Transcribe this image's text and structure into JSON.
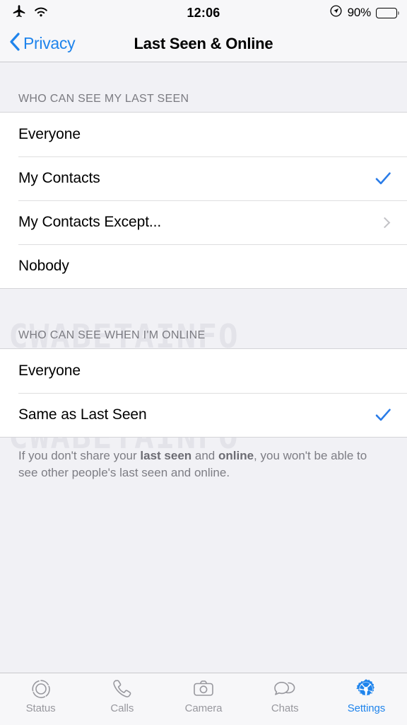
{
  "status_bar": {
    "airplane_icon": "airplane-icon",
    "wifi_icon": "wifi-icon",
    "time": "12:06",
    "location_icon": "location-icon",
    "battery_percent": "90%",
    "battery_level": 90,
    "battery_color": "#fcc202"
  },
  "nav": {
    "back_label": "Privacy",
    "back_icon": "chevron-left-icon",
    "title": "Last Seen & Online",
    "tint": "#1f84ec"
  },
  "watermark": "CWABETAINFO",
  "sections": [
    {
      "header": "WHO CAN SEE MY LAST SEEN",
      "rows": [
        {
          "label": "Everyone",
          "accessory": "none"
        },
        {
          "label": "My Contacts",
          "accessory": "check"
        },
        {
          "label": "My Contacts Except...",
          "accessory": "chevron"
        },
        {
          "label": "Nobody",
          "accessory": "none"
        }
      ]
    },
    {
      "header": "WHO CAN SEE WHEN I'M ONLINE",
      "rows": [
        {
          "label": "Everyone",
          "accessory": "none"
        },
        {
          "label": "Same as Last Seen",
          "accessory": "check"
        }
      ]
    }
  ],
  "footer": {
    "part1": "If you don't share your ",
    "bold1": "last seen",
    "part2": " and ",
    "bold2": "online",
    "part3": ", you won't be able to see other people's last seen and online."
  },
  "tabbar": {
    "items": [
      {
        "label": "Status",
        "icon": "status-rings-icon",
        "active": false
      },
      {
        "label": "Calls",
        "icon": "phone-icon",
        "active": false
      },
      {
        "label": "Camera",
        "icon": "camera-icon",
        "active": false
      },
      {
        "label": "Chats",
        "icon": "chat-bubbles-icon",
        "active": false
      },
      {
        "label": "Settings",
        "icon": "gear-icon",
        "active": true
      }
    ],
    "active_color": "#1f84ec",
    "inactive_color": "#98989e"
  },
  "colors": {
    "accent": "#1f84ec",
    "check": "#2a7ce8",
    "background": "#f1f1f5",
    "row_background": "#ffffff",
    "header_text": "#7b7b81"
  }
}
